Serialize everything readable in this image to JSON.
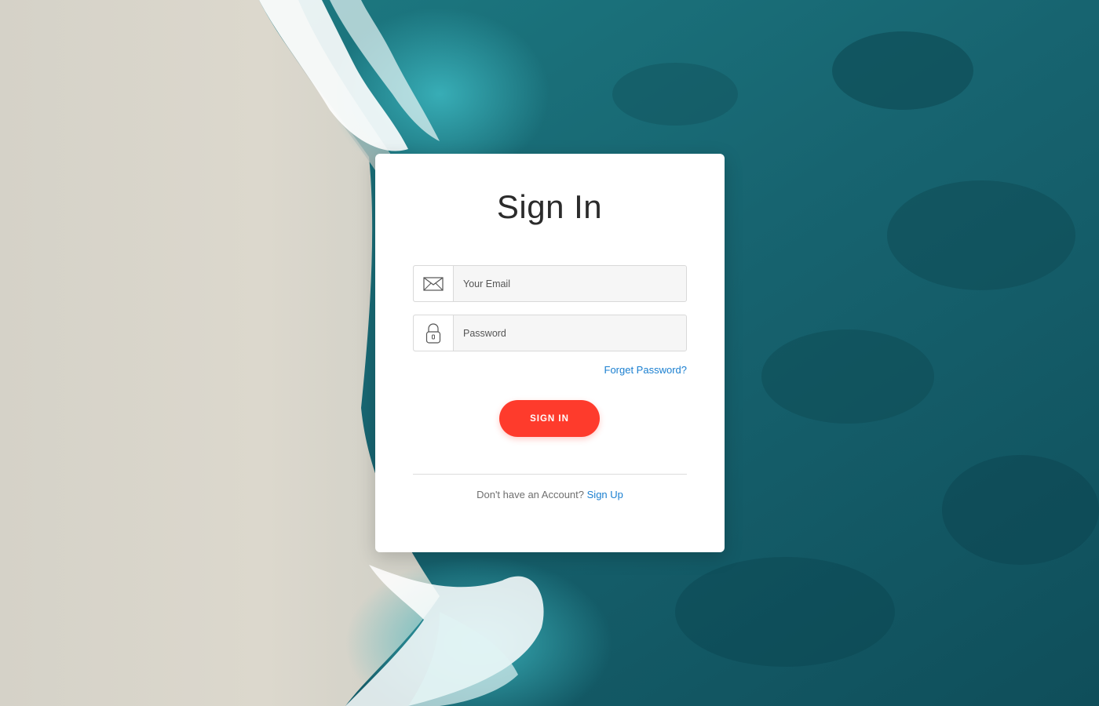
{
  "page": {
    "title": "Sign In"
  },
  "form": {
    "email": {
      "placeholder": "Your Email",
      "value": "",
      "icon": "envelope-icon"
    },
    "password": {
      "placeholder": "Password",
      "value": "",
      "icon": "padlock-icon"
    },
    "forgot_label": "Forget Password?",
    "submit_label": "SIGN IN"
  },
  "footer": {
    "prompt": "Don't have an Account?",
    "signup_label": "Sign Up"
  },
  "colors": {
    "accent_button": "#fe3b2c",
    "link": "#1a7fd0",
    "ocean": "#17636b",
    "sand": "#d8d4ca"
  }
}
